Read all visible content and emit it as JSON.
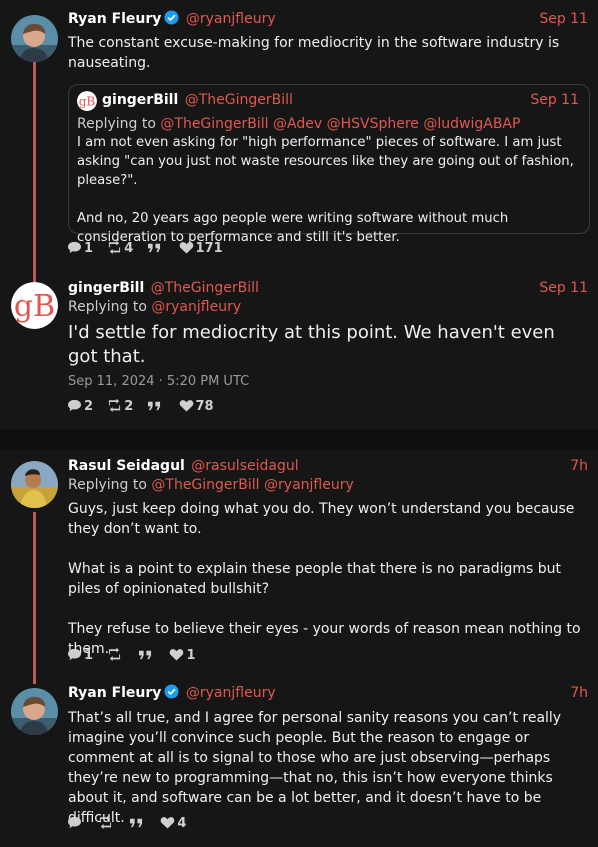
{
  "colors": {
    "accent": "#e2574f",
    "thread_line": "#bd5b5b",
    "verified": "#1d9bf0",
    "background": "#161616",
    "separator": "#0f0f0f"
  },
  "tweet1": {
    "fullname": "Ryan Fleury",
    "handle": "@ryanjfleury",
    "date": "Sep 11",
    "verified": true,
    "text": "The constant excuse-making for mediocrity in the software industry is nauseating.",
    "quote": {
      "fullname": "gingerBill",
      "handle": "@TheGingerBill",
      "date": "Sep 11",
      "replying_label": "Replying to",
      "replying_to": [
        "@TheGingerBill",
        "@Adev",
        "@HSVSphere",
        "@ludwigABAP"
      ],
      "text": "I am not even asking for \"high performance\" pieces of software. I am just asking \"can you just not waste resources like they are going out of fashion, please?\".\n\nAnd no, 20 years ago people were writing software without much consideration to performance and still it's better."
    },
    "stats": {
      "comments": "1",
      "retweets": "4",
      "quotes": "",
      "likes": "171"
    }
  },
  "tweet2": {
    "fullname": "gingerBill",
    "handle": "@TheGingerBill",
    "date": "Sep 11",
    "replying_label": "Replying to",
    "replying_to": [
      "@ryanjfleury"
    ],
    "text": "I'd settle for mediocrity at this point. We haven't even got that.",
    "timestamp": "Sep 11, 2024 · 5:20 PM UTC",
    "stats": {
      "comments": "2",
      "retweets": "2",
      "quotes": "",
      "likes": "78"
    }
  },
  "tweet3": {
    "fullname": "Rasul Seidagul",
    "handle": "@rasulseidagul",
    "date": "7h",
    "replying_label": "Replying to",
    "replying_to": [
      "@TheGingerBill",
      "@ryanjfleury"
    ],
    "text": "Guys, just keep doing what you do. They won’t understand you because they don’t want to.\n\nWhat is a point to explain these people that there is no paradigms but piles of opinionated bullshit?\n\nThey refuse to believe their eyes - your words of reason mean nothing to them.",
    "stats": {
      "comments": "1",
      "retweets": "",
      "quotes": "",
      "likes": "1"
    }
  },
  "tweet4": {
    "fullname": "Ryan Fleury",
    "handle": "@ryanjfleury",
    "date": "7h",
    "verified": true,
    "text": "That’s all true, and I agree for personal sanity reasons you can’t really imagine you’ll convince such people. But the reason to engage or comment at all is to signal to those who are just observing—perhaps they’re new to programming—that no, this isn’t how everyone thinks about it, and software can be a lot better, and it doesn’t have to be difficult.",
    "stats": {
      "comments": "",
      "retweets": "",
      "quotes": "",
      "likes": "4"
    }
  },
  "icons": {
    "comment": "comment-icon",
    "retweet": "retweet-icon",
    "quote": "quote-icon",
    "like": "heart-icon",
    "verified": "verified-badge-icon"
  }
}
